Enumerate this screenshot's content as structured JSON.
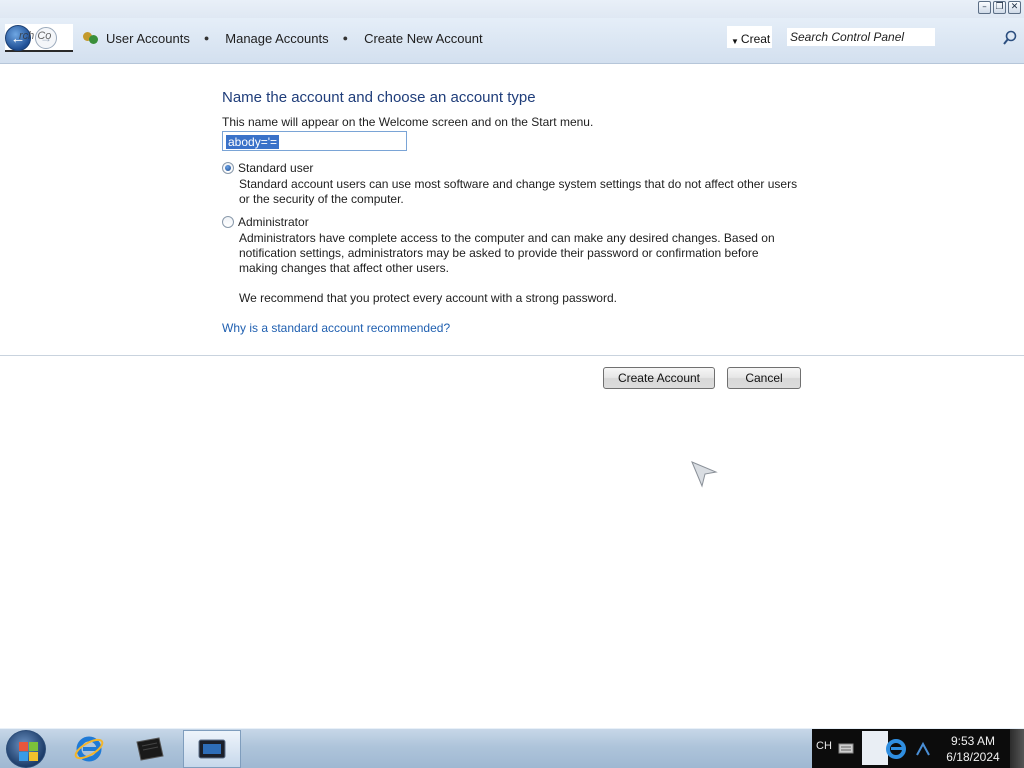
{
  "nav": {
    "ghost_text": "rch Co",
    "breadcrumb": [
      "User Accounts",
      "Manage Accounts",
      "Create New Account"
    ],
    "refresh_text": "Creat",
    "search_placeholder": "Search Control Panel"
  },
  "main": {
    "heading": "Name the account and choose an account type",
    "subtitle": "This name will appear on the Welcome screen and on the Start menu.",
    "name_value": "abody='=",
    "options": [
      {
        "label": "Standard user",
        "checked": true,
        "description": "Standard account users can use most software and change system settings that do not affect other users or the security of the computer."
      },
      {
        "label": "Administrator",
        "checked": false,
        "description": "Administrators have complete access to the computer and can make any desired changes. Based on notification settings, administrators may be asked to provide their password or confirmation before making changes that affect other users."
      }
    ],
    "recommendation": "We recommend that you protect every account with a strong password.",
    "help_link": "Why is a standard account recommended?",
    "create_button": "Create Account",
    "cancel_button": "Cancel"
  },
  "taskbar": {
    "apps": [
      "internet-explorer-icon",
      "terminal-icon",
      "media-app-icon"
    ],
    "language": "CH",
    "time": "9:53 AM",
    "date": "6/18/2024"
  },
  "colors": {
    "heading": "#1f3d7a",
    "link": "#1f5fb0",
    "selection": "#3a72c9"
  }
}
